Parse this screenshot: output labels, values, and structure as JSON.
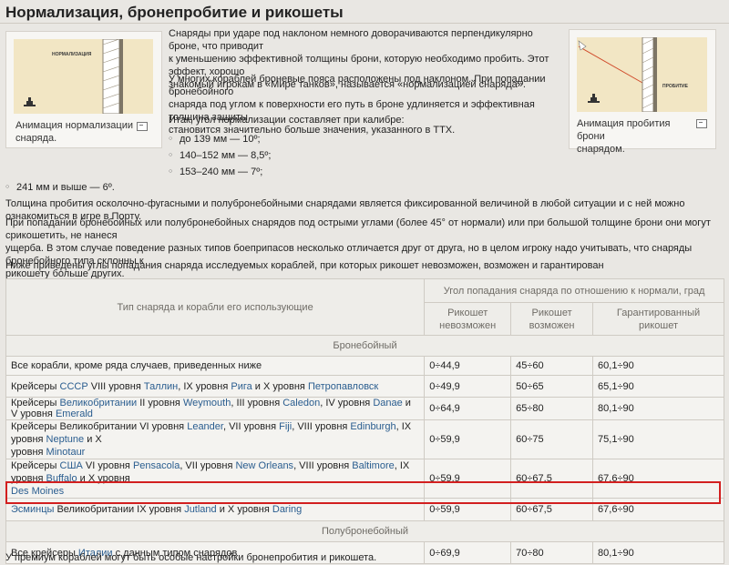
{
  "title": "Нормализация, бронепробитие и рикошеты",
  "left_figure": {
    "img_label": "НОРМАЛИЗАЦИЯ",
    "caption_line1": "Анимация нормализации",
    "caption_line2": "снаряда."
  },
  "right_figure": {
    "img_label": "ПРОБИТИЕ",
    "caption_line1": "Анимация пробития брони",
    "caption_line2": "снарядом."
  },
  "intro": {
    "p1_l1": "Снаряды при ударе под наклоном немного доворачиваются перпендикулярно броне, что приводит",
    "p1_l2": "к уменьшению эффективной толщины брони, которую необходимо пробить. Этот эффект, хорошо",
    "p1_l3": "знакомый игрокам в «Мире танков», называется «нормализацией снаряда».",
    "p2_l1": "У многих кораблей броневые пояса расположены под наклоном. При попадании бронебойного",
    "p2_l2": "снаряда под углом к поверхности его путь в броне удлиняется и эффективная толщина защиты",
    "p2_l3": "становится значительно больше значения, указанного в ТТХ.",
    "p3": "Итак, угол нормализации составляет при калибре:"
  },
  "calibers": [
    "до 139 мм — 10º;",
    "140–152 мм — 8,5º;",
    "153–240 мм — 7º;",
    "241 мм и выше — 6º."
  ],
  "body": {
    "p4": "Толщина пробития осколочно-фугасными и полубронебойными снарядами является фиксированной величиной в любой ситуации и с ней можно ознакомиться в игре в Порту.",
    "p5_l1": "При попадании бронебойных или полубронебойных снарядов под острыми углами (более 45° от нормали) или при большой толщине брони они могут срикошетить, не нанеся",
    "p5_l2": "ущерба. В этом случае поведение разных типов боеприпасов несколько отличается друг от друга, но в целом игроку надо учитывать, что снаряды бронебойного типа склонны к",
    "p5_l3": "рикошету больше других.",
    "p6": "Ниже приведены углы попадания снаряда исследуемых кораблей, при которых рикошет невозможен, возможен и гарантирован"
  },
  "table": {
    "h_type": "Тип снаряда и корабли его использующие",
    "h_angle": "Угол попадания снаряда по отношению к нормали, град",
    "h_no_l1": "Рикошет",
    "h_no_l2": "невозможен",
    "h_maybe_l1": "Рикошет",
    "h_maybe_l2": "возможен",
    "h_yes_l1": "Гарантированный",
    "h_yes_l2": "рикошет",
    "cat_ap": "Бронебойный",
    "cat_sap": "Полубронебойный",
    "rows": [
      {
        "no": "0÷44,9",
        "maybe": "45÷60",
        "yes": "60,1÷90"
      },
      {
        "no": "0÷49,9",
        "maybe": "50÷65",
        "yes": "65,1÷90"
      },
      {
        "no": "0÷64,9",
        "maybe": "65÷80",
        "yes": "80,1÷90"
      },
      {
        "no": "0÷59,9",
        "maybe": "60÷75",
        "yes": "75,1÷90"
      },
      {
        "no": "0÷59,9",
        "maybe": "60÷67,5",
        "yes": "67,6÷90"
      },
      {
        "no": "0÷59,9",
        "maybe": "60÷67,5",
        "yes": "67,6÷90"
      },
      {
        "no": "0÷69,9",
        "maybe": "70÷80",
        "yes": "80,1÷90"
      }
    ],
    "r0": {
      "t": "Все корабли, кроме ряда случаев, приведенных ниже"
    },
    "r1": {
      "a": "Крейсеры ",
      "b": "СССР",
      "c": " VIII уровня ",
      "d": "Таллин",
      "e": ", IX уровня ",
      "f": "Рига",
      "g": " и X уровня ",
      "h": "Петропавловск"
    },
    "r2": {
      "a": "Крейсеры ",
      "b": "Великобритании",
      "c": " II уровня ",
      "d": "Weymouth",
      "e": ", III уровня ",
      "f": "Caledon",
      "g": ", IV уровня ",
      "h": "Danae",
      "i": " и V уровня ",
      "j": "Emerald"
    },
    "r3": {
      "a": "Крейсеры Великобритании VI уровня ",
      "b": "Leander",
      "c": ", VII уровня ",
      "d": "Fiji",
      "e": ", VIII уровня ",
      "f": "Edinburgh",
      "g": ", IX уровня ",
      "h": "Neptune",
      "i": " и X",
      "j": "уровня ",
      "k": "Minotaur"
    },
    "r4": {
      "a": "Крейсеры ",
      "b": "США",
      "c": " VI уровня ",
      "d": "Pensacola",
      "e": ", VII уровня ",
      "f": "New Orleans",
      "g": ", VIII уровня ",
      "h": "Baltimore",
      "i": ", IX уровня ",
      "j": "Buffalo",
      "k": " и X уровня",
      "l": "Des Moines"
    },
    "r5": {
      "a": "Эсминцы",
      "b": " Великобритании IX уровня ",
      "c": "Jutland",
      "d": " и X уровня ",
      "e": "Daring"
    },
    "r6": {
      "a": "Все крейсеры ",
      "b": "Италии",
      "c": " с данным типом снарядов"
    }
  },
  "footer": "У премиум кораблей могут быть особые настройки бронепробития и рикошета."
}
